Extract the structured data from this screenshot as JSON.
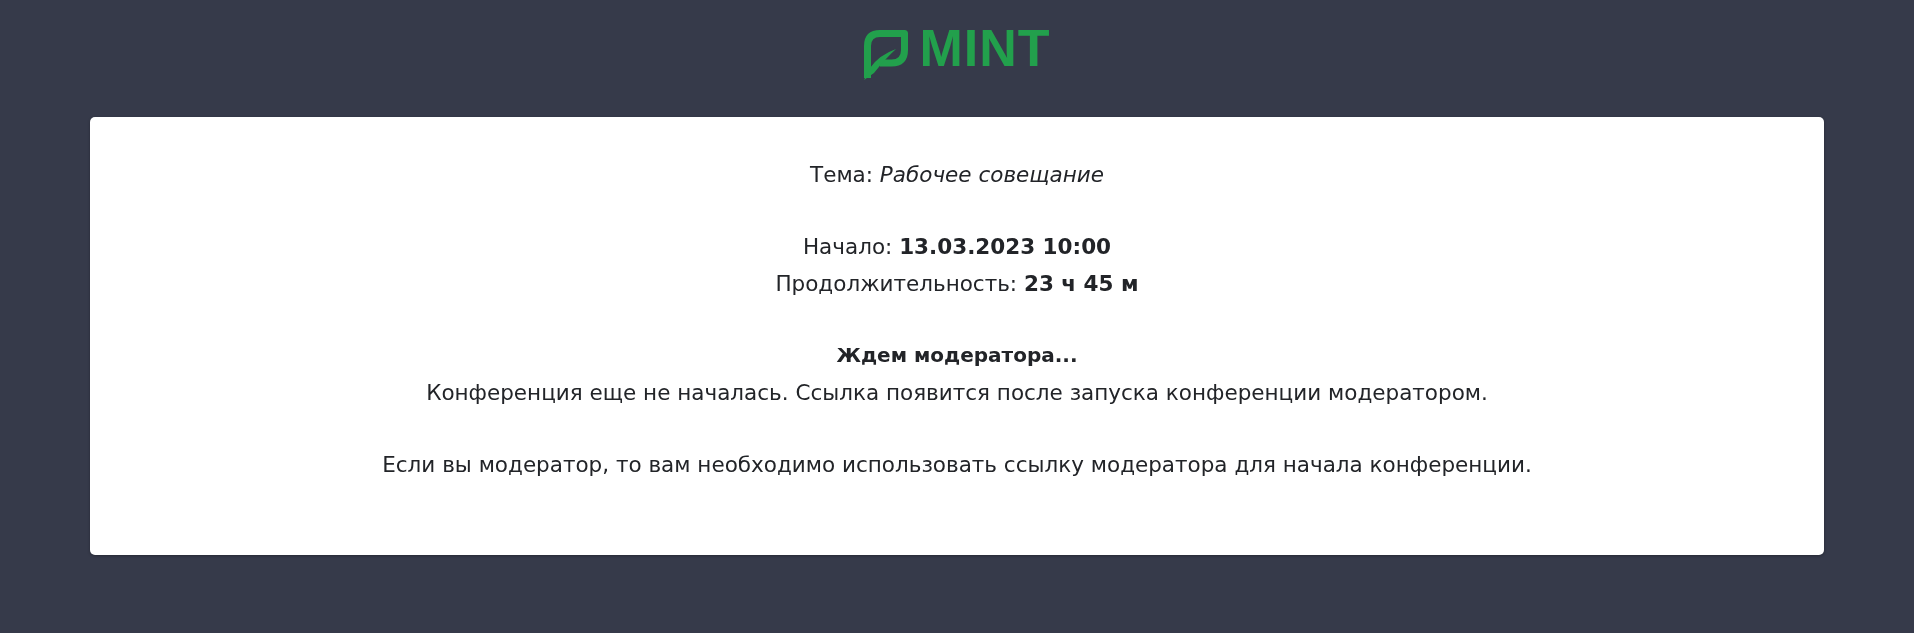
{
  "header": {
    "logo_text": "MINT"
  },
  "card": {
    "sections": [
      {
        "lines": [
          {
            "kind": "detail",
            "text": "Тема: *Рабочее совещание*"
          }
        ]
      },
      {
        "lines": [
          {
            "kind": "detail",
            "text": "Начало: **13.03.2023 10:00**"
          },
          {
            "kind": "detail",
            "text": "Продолжительность: **23 ч 45 м**"
          }
        ]
      },
      {
        "lines": [
          {
            "kind": "heading",
            "text": "Ждем модератора..."
          },
          {
            "kind": "message",
            "text": "Конференция еще не началась. Ссылка появится после запуска конференции модератором."
          }
        ]
      },
      {
        "lines": [
          {
            "kind": "message",
            "text": "Если вы модератор, то вам необходимо использовать ссылку модератора для начала конференции."
          }
        ]
      }
    ]
  }
}
